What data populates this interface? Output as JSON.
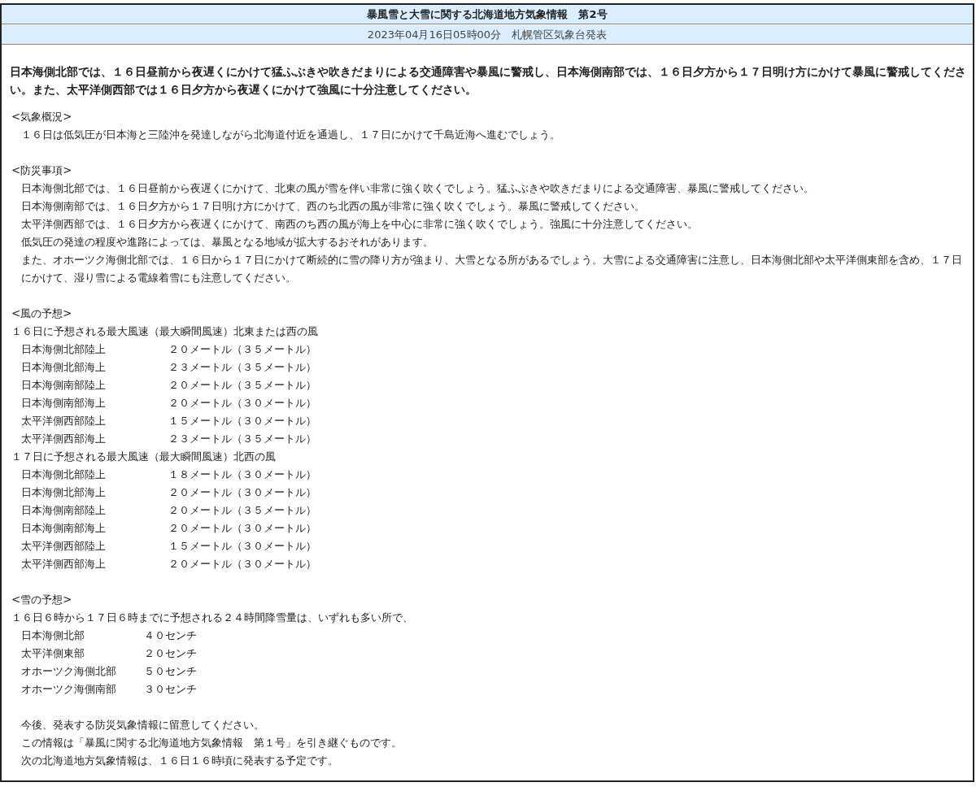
{
  "title": "暴風雪と大雪に関する北海道地方気象情報　第2号",
  "issued": "2023年04月16日05時00分　札幌管区気象台発表",
  "headline": "日本海側北部では、１６日昼前から夜遅くにかけて猛ふぶきや吹きだまりによる交通障害や暴風に警戒し、日本海側南部では、１６日夕方から１７日明け方にかけて暴風に警戒してください。また、太平洋側西部では１６日夕方から夜遅くにかけて強風に十分注意してください。",
  "sections": [
    {
      "kind": "text",
      "heading": "<気象概況>",
      "lines": [
        {
          "kind": "indent",
          "text": "１６日は低気圧が日本海と三陸沖を発達しながら北海道付近を通過し、１７日にかけて千島近海へ進むでしょう。"
        }
      ]
    },
    {
      "kind": "text",
      "heading": "<防災事項>",
      "lines": [
        {
          "kind": "indent",
          "text": "日本海側北部では、１６日昼前から夜遅くにかけて、北東の風が雪を伴い非常に強く吹くでしょう。猛ふぶきや吹きだまりによる交通障害、暴風に警戒してください。"
        },
        {
          "kind": "indent",
          "text": "日本海側南部では、１６日夕方から１７日明け方にかけて、西のち北西の風が非常に強く吹くでしょう。暴風に警戒してください。"
        },
        {
          "kind": "indent",
          "text": "太平洋側西部では、１６日夕方から夜遅くにかけて、南西のち西の風が海上を中心に非常に強く吹くでしょう。強風に十分注意してください。"
        },
        {
          "kind": "indent",
          "text": "低気圧の発達の程度や進路によっては、暴風となる地域が拡大するおそれがあります。"
        },
        {
          "kind": "indent",
          "text": "また、オホーツク海側北部では、１６日から１７日にかけて断続的に雪の降り方が強まり、大雪となる所があるでしょう。大雪による交通障害に注意し、日本海側北部や太平洋側東部を含め、１７日にかけて、湿り雪による電線着雪にも注意してください。"
        }
      ]
    },
    {
      "kind": "wind",
      "heading": "<風の予想>",
      "lines": [
        {
          "kind": "lead",
          "text": "１６日に予想される最大風速（最大瞬間風速）北東または西の風"
        },
        {
          "kind": "row",
          "label": "日本海側北部陸上",
          "value": "２０メートル（３５メートル）"
        },
        {
          "kind": "row",
          "label": "日本海側北部海上",
          "value": "２３メートル（３５メートル）"
        },
        {
          "kind": "row",
          "label": "日本海側南部陸上",
          "value": "２０メートル（３５メートル）"
        },
        {
          "kind": "row",
          "label": "日本海側南部海上",
          "value": "２０メートル（３０メートル）"
        },
        {
          "kind": "row",
          "label": "太平洋側西部陸上",
          "value": "１５メートル（３０メートル）"
        },
        {
          "kind": "row",
          "label": "太平洋側西部海上",
          "value": "２３メートル（３５メートル）"
        },
        {
          "kind": "lead",
          "text": "１７日に予想される最大風速（最大瞬間風速）北西の風"
        },
        {
          "kind": "row",
          "label": "日本海側北部陸上",
          "value": "１８メートル（３０メートル）"
        },
        {
          "kind": "row",
          "label": "日本海側北部海上",
          "value": "２０メートル（３０メートル）"
        },
        {
          "kind": "row",
          "label": "日本海側南部陸上",
          "value": "２０メートル（３５メートル）"
        },
        {
          "kind": "row",
          "label": "日本海側南部海上",
          "value": "２０メートル（３０メートル）"
        },
        {
          "kind": "row",
          "label": "太平洋側西部陸上",
          "value": "１５メートル（３０メートル）"
        },
        {
          "kind": "row",
          "label": "太平洋側西部海上",
          "value": "２０メートル（３０メートル）"
        }
      ]
    },
    {
      "kind": "snow",
      "heading": "<雪の予想>",
      "lines": [
        {
          "kind": "lead",
          "text": "１６日６時から１７日６時までに予想される２４時間降雪量は、いずれも多い所で、"
        },
        {
          "kind": "row",
          "label": "日本海側北部",
          "value": "４０センチ"
        },
        {
          "kind": "row",
          "label": "太平洋側東部",
          "value": "２０センチ"
        },
        {
          "kind": "row",
          "label": "オホーツク海側北部",
          "value": "５０センチ"
        },
        {
          "kind": "row",
          "label": "オホーツク海側南部",
          "value": "３０センチ"
        }
      ]
    },
    {
      "kind": "text",
      "lines": [
        {
          "kind": "indent",
          "text": "今後、発表する防災気象情報に留意してください。"
        },
        {
          "kind": "indent",
          "text": "この情報は「暴風に関する北海道地方気象情報　第１号」を引き継ぐものです。"
        },
        {
          "kind": "indent",
          "text": "次の北海道地方気象情報は、１６日１６時頃に発表する予定です。"
        }
      ]
    }
  ]
}
